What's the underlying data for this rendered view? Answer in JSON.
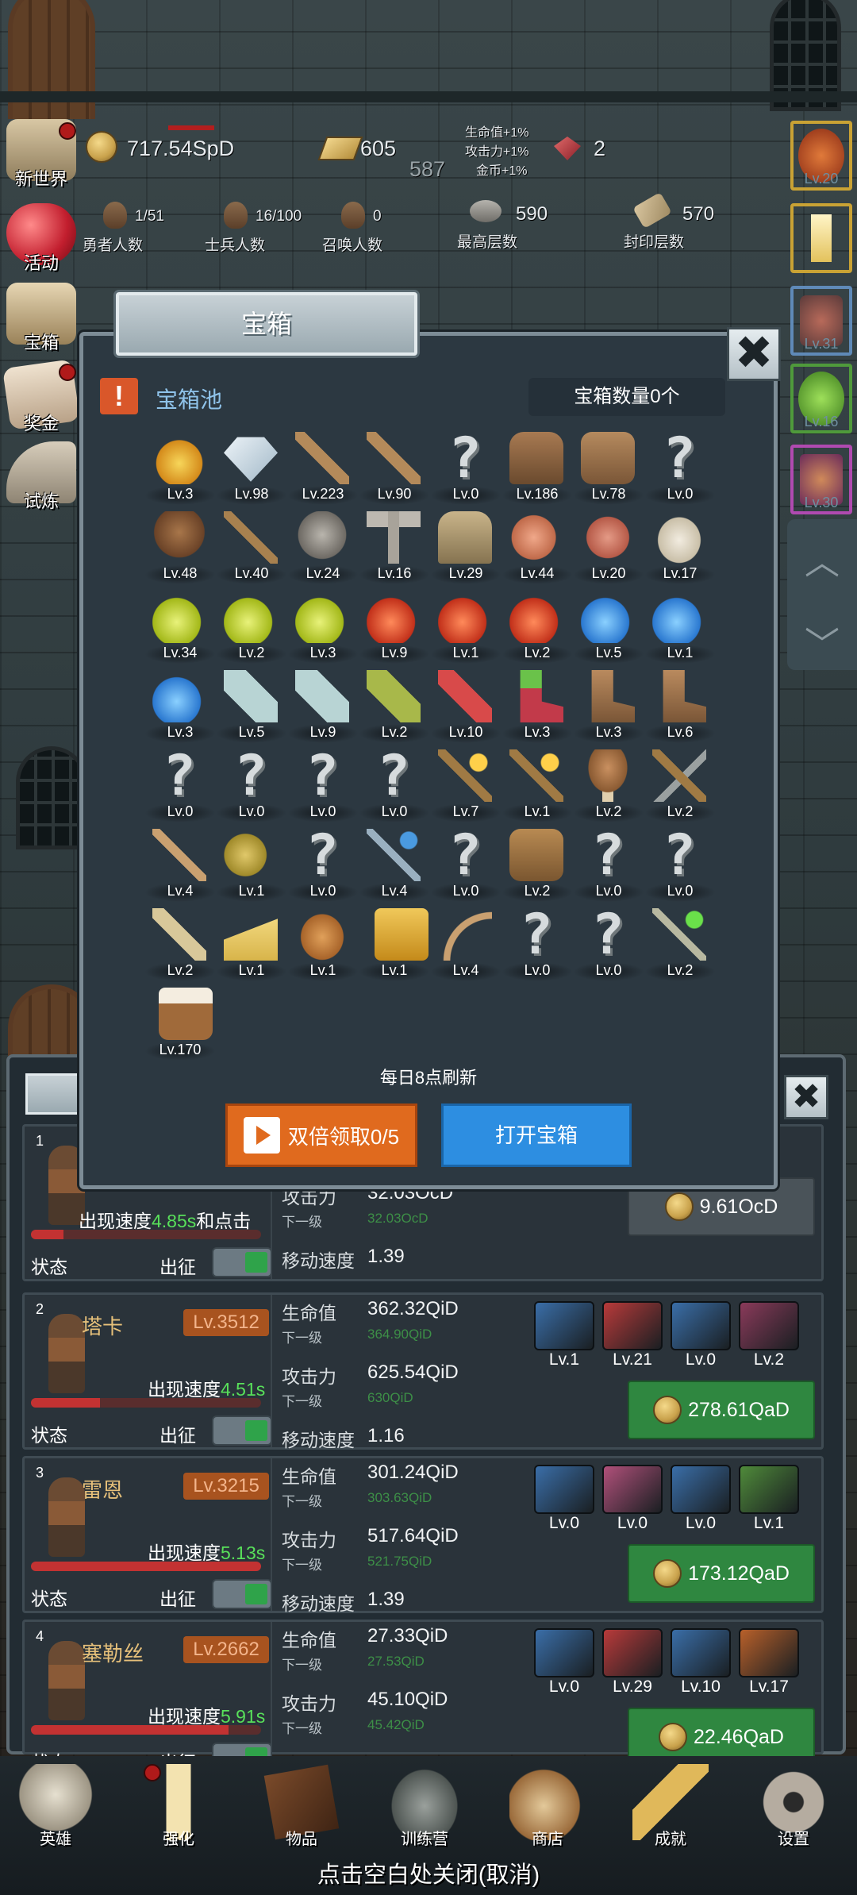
{
  "top_bar": {
    "coins": "717.54SpD",
    "gold": "605",
    "gold_sub": "587",
    "bonus_lines": [
      "生命值+1%",
      "攻击力+1%",
      "金币+1%"
    ],
    "gems": "2",
    "hero_count": "1/51",
    "hero_count_label": "勇者人数",
    "soldier_count": "16/100",
    "soldier_count_label": "士兵人数",
    "summon_count": "0",
    "summon_count_label": "召唤人数",
    "max_floor": "590",
    "max_floor_label": "最高层数",
    "sealed_floor": "570",
    "sealed_floor_label": "封印层数"
  },
  "side_menu": [
    "新世界",
    "活动",
    "宝箱",
    "奖金",
    "试炼"
  ],
  "right_slots": [
    {
      "lv": "Lv.20",
      "color": "#c94a2a"
    },
    {
      "lv": "",
      "color": "#d6a23a"
    },
    {
      "lv": "Lv.31",
      "color": "#4a6fa8"
    },
    {
      "lv": "Lv.16",
      "color": "#4f9a3b"
    },
    {
      "lv": "Lv.30",
      "color": "#8a3a8a"
    }
  ],
  "modal": {
    "title": "宝箱",
    "pool_title": "宝箱池",
    "alert": "!",
    "chest_count": "宝箱数量0个",
    "refresh_text": "每日8点刷新",
    "double_button": "双倍领取0/5",
    "open_button": "打开宝箱",
    "close": "✖",
    "items": [
      {
        "n": "crown",
        "lv": "Lv.3"
      },
      {
        "n": "diamond",
        "lv": "Lv.98"
      },
      {
        "n": "sword",
        "lv": "Lv.223"
      },
      {
        "n": "sword",
        "lv": "Lv.90"
      },
      {
        "n": "unknown",
        "lv": "Lv.0"
      },
      {
        "n": "armor",
        "lv": "Lv.186"
      },
      {
        "n": "backpack",
        "lv": "Lv.78"
      },
      {
        "n": "unknown",
        "lv": "Lv.0"
      },
      {
        "n": "helmet",
        "lv": "Lv.48"
      },
      {
        "n": "dagger",
        "lv": "Lv.40"
      },
      {
        "n": "knight-helmet",
        "lv": "Lv.24"
      },
      {
        "n": "hammer",
        "lv": "Lv.16"
      },
      {
        "n": "great-helm",
        "lv": "Lv.29"
      },
      {
        "n": "ham",
        "lv": "Lv.44"
      },
      {
        "n": "steak",
        "lv": "Lv.20"
      },
      {
        "n": "rice",
        "lv": "Lv.17"
      },
      {
        "n": "yellow-potion",
        "lv": "Lv.34"
      },
      {
        "n": "yellow-potion",
        "lv": "Lv.2"
      },
      {
        "n": "yellow-potion",
        "lv": "Lv.3"
      },
      {
        "n": "red-potion",
        "lv": "Lv.9"
      },
      {
        "n": "red-potion",
        "lv": "Lv.1"
      },
      {
        "n": "red-potion",
        "lv": "Lv.2"
      },
      {
        "n": "blue-potion",
        "lv": "Lv.5"
      },
      {
        "n": "blue-potion",
        "lv": "Lv.1"
      },
      {
        "n": "blue-potion",
        "lv": "Lv.3"
      },
      {
        "n": "empty-bottle",
        "lv": "Lv.5"
      },
      {
        "n": "empty-bottle",
        "lv": "Lv.9"
      },
      {
        "n": "green-bottle",
        "lv": "Lv.2"
      },
      {
        "n": "red-vial",
        "lv": "Lv.10"
      },
      {
        "n": "winged-boot",
        "lv": "Lv.3"
      },
      {
        "n": "boot",
        "lv": "Lv.3"
      },
      {
        "n": "boot",
        "lv": "Lv.6"
      },
      {
        "n": "unknown",
        "lv": "Lv.0"
      },
      {
        "n": "unknown",
        "lv": "Lv.0"
      },
      {
        "n": "unknown",
        "lv": "Lv.0"
      },
      {
        "n": "unknown",
        "lv": "Lv.0"
      },
      {
        "n": "torch",
        "lv": "Lv.7"
      },
      {
        "n": "torch",
        "lv": "Lv.1"
      },
      {
        "n": "mushroom",
        "lv": "Lv.2"
      },
      {
        "n": "pickaxe",
        "lv": "Lv.2"
      },
      {
        "n": "staff",
        "lv": "Lv.4"
      },
      {
        "n": "potatoes",
        "lv": "Lv.1"
      },
      {
        "n": "unknown",
        "lv": "Lv.0"
      },
      {
        "n": "scepter",
        "lv": "Lv.4"
      },
      {
        "n": "unknown",
        "lv": "Lv.0"
      },
      {
        "n": "leather-bag",
        "lv": "Lv.2"
      },
      {
        "n": "unknown",
        "lv": "Lv.0"
      },
      {
        "n": "unknown",
        "lv": "Lv.0"
      },
      {
        "n": "club",
        "lv": "Lv.2"
      },
      {
        "n": "cheese",
        "lv": "Lv.1"
      },
      {
        "n": "pie",
        "lv": "Lv.1"
      },
      {
        "n": "honey-jar",
        "lv": "Lv.1"
      },
      {
        "n": "bow",
        "lv": "Lv.4"
      },
      {
        "n": "unknown",
        "lv": "Lv.0"
      },
      {
        "n": "unknown",
        "lv": "Lv.0"
      },
      {
        "n": "green-wand",
        "lv": "Lv.2"
      },
      {
        "n": "beer-mug",
        "lv": "Lv.170"
      }
    ]
  },
  "heroes": [
    {
      "num": "1",
      "name": "",
      "lv": "",
      "speed_prefix": "出现速度",
      "speed": "4.85s",
      "speed_suffix": "和点击",
      "hp": 0.14,
      "stats": [
        {
          "l": "攻击力",
          "v": "32.03OcD",
          "sl": "下一级",
          "sv": "32.03OcD"
        },
        {
          "l": "移动速度",
          "v": "1.39"
        }
      ],
      "price": "9.61OcD",
      "state": "状态",
      "sortie": "出征",
      "equips": []
    },
    {
      "num": "2",
      "name": "塔卡",
      "lv": "Lv.3512",
      "speed_prefix": "出现速度",
      "speed": "4.51s",
      "speed_suffix": "",
      "hp": 0.3,
      "stats": [
        {
          "l": "生命值",
          "v": "362.32QiD",
          "sl": "下一级",
          "sv": "364.90QiD"
        },
        {
          "l": "攻击力",
          "v": "625.54QiD",
          "sl": "下一级",
          "sv": "630QiD"
        },
        {
          "l": "移动速度",
          "v": "1.16"
        }
      ],
      "price": "278.61QaD",
      "state": "状态",
      "sortie": "出征",
      "equips": [
        {
          "lv": "Lv.1",
          "c": "#3a6ea8"
        },
        {
          "lv": "Lv.21",
          "c": "#b83a3a"
        },
        {
          "lv": "Lv.0",
          "c": "#3a6ea8"
        },
        {
          "lv": "Lv.2",
          "c": "#8a3a5a"
        }
      ]
    },
    {
      "num": "3",
      "name": "雷恩",
      "lv": "Lv.3215",
      "speed_prefix": "出现速度",
      "speed": "5.13s",
      "speed_suffix": "",
      "hp": 1.0,
      "stats": [
        {
          "l": "生命值",
          "v": "301.24QiD",
          "sl": "下一级",
          "sv": "303.63QiD"
        },
        {
          "l": "攻击力",
          "v": "517.64QiD",
          "sl": "下一级",
          "sv": "521.75QiD"
        },
        {
          "l": "移动速度",
          "v": "1.39"
        }
      ],
      "price": "173.12QaD",
      "state": "状态",
      "sortie": "出征",
      "equips": [
        {
          "lv": "Lv.0",
          "c": "#3a6ea8"
        },
        {
          "lv": "Lv.0",
          "c": "#b0507a"
        },
        {
          "lv": "Lv.0",
          "c": "#3a6ea8"
        },
        {
          "lv": "Lv.1",
          "c": "#4f8a3a"
        }
      ]
    },
    {
      "num": "4",
      "name": "塞勒丝",
      "lv": "Lv.2662",
      "speed_prefix": "出现速度",
      "speed": "5.91s",
      "speed_suffix": "",
      "hp": 0.86,
      "stats": [
        {
          "l": "生命值",
          "v": "27.33QiD",
          "sl": "下一级",
          "sv": "27.53QiD"
        },
        {
          "l": "攻击力",
          "v": "45.10QiD",
          "sl": "下一级",
          "sv": "45.42QiD"
        }
      ],
      "price": "22.46QaD",
      "state": "状态",
      "sortie": "出征",
      "equips": [
        {
          "lv": "Lv.0",
          "c": "#3a6ea8"
        },
        {
          "lv": "Lv.29",
          "c": "#b83a3a"
        },
        {
          "lv": "Lv.10",
          "c": "#3a6ea8"
        },
        {
          "lv": "Lv.17",
          "c": "#b8602a"
        }
      ]
    }
  ],
  "bottom_nav": [
    "英雄",
    "强化",
    "物品",
    "训练营",
    "商店",
    "成就",
    "设置"
  ],
  "close_hint": "点击空白处关闭(取消)"
}
